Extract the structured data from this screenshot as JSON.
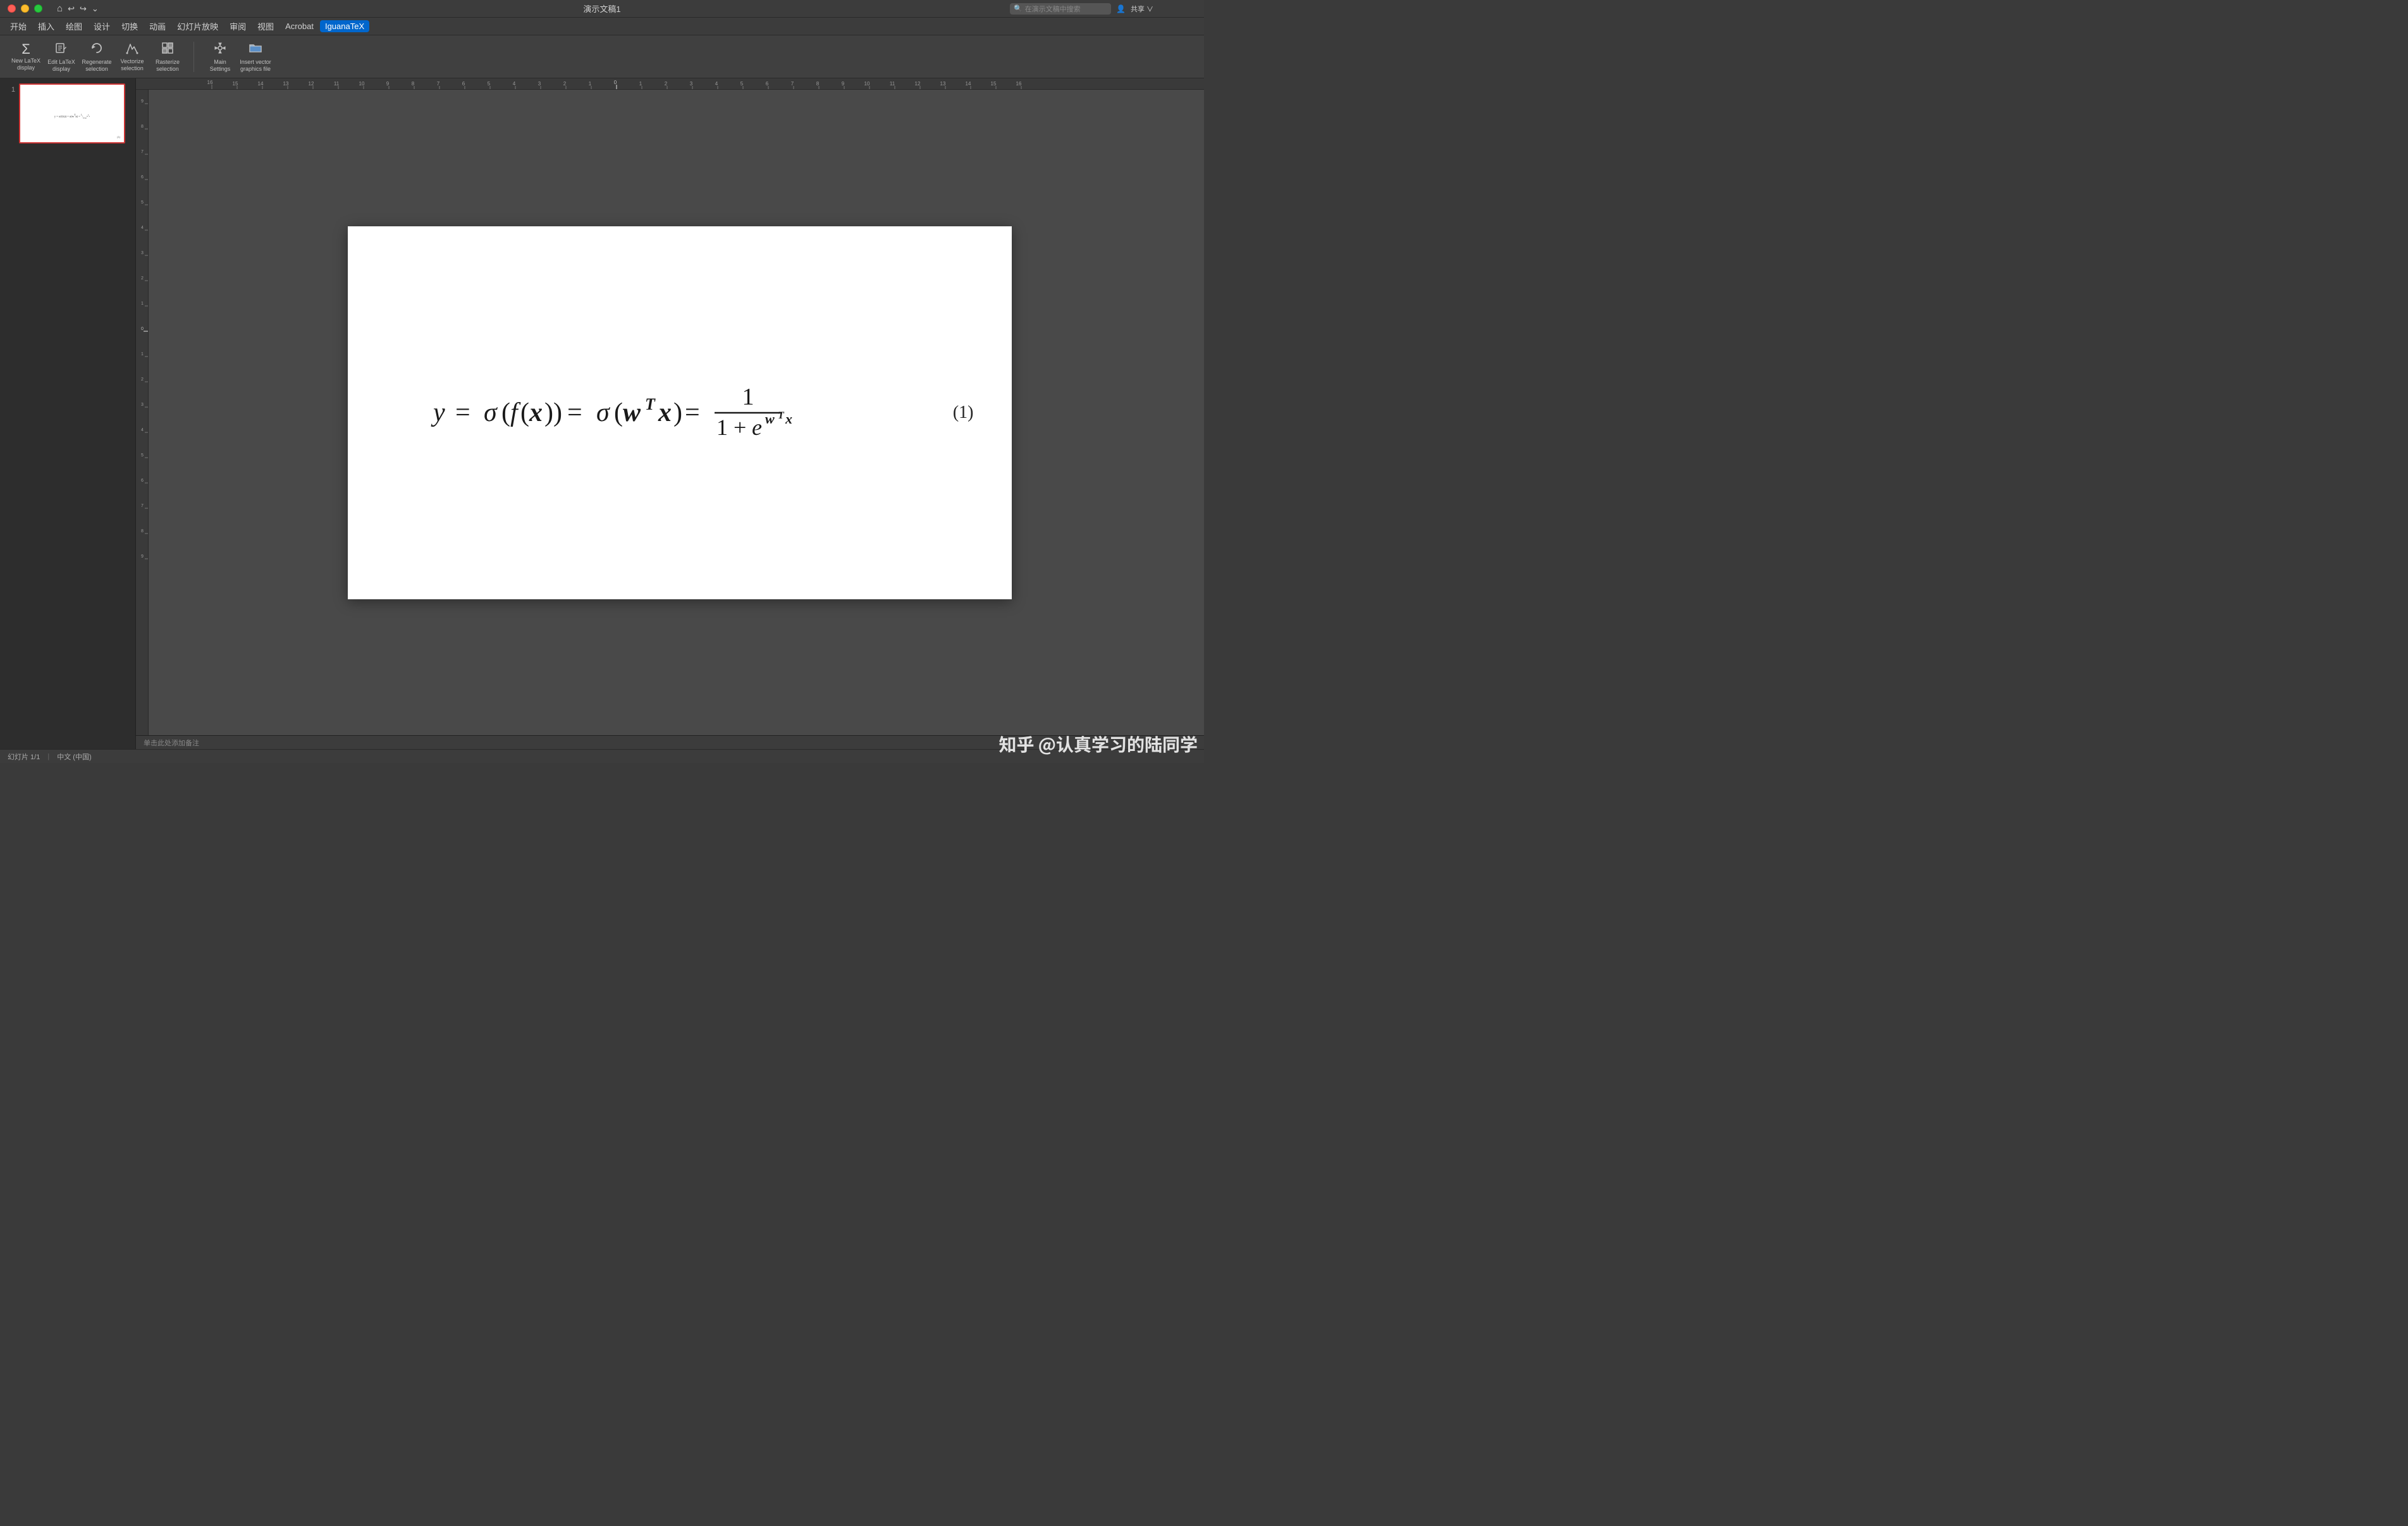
{
  "titlebar": {
    "title": "演示文稿1",
    "search_placeholder": "在演示文稿中搜索"
  },
  "menubar": {
    "items": [
      "开始",
      "插入",
      "绘图",
      "设计",
      "切换",
      "动画",
      "幻灯片放映",
      "审阅",
      "视图",
      "Acrobat",
      "IguanaTeX"
    ]
  },
  "ribbon": {
    "groups": [
      {
        "buttons": [
          {
            "id": "new-latex",
            "icon": "Σ",
            "label": "New LaTeX\ndisplay"
          },
          {
            "id": "edit-latex",
            "icon": "✎",
            "label": "Edit LaTeX\ndisplay"
          },
          {
            "id": "regenerate",
            "icon": "↺",
            "label": "Regenerate\nselection"
          },
          {
            "id": "vectorize",
            "icon": "⟨⟩",
            "label": "Vectorize\nselection"
          },
          {
            "id": "rasterize",
            "icon": "⊞",
            "label": "Rasterize\nselection"
          }
        ]
      },
      {
        "buttons": [
          {
            "id": "main-settings",
            "icon": "⚙",
            "label": "Main\nSettings"
          },
          {
            "id": "insert-vector",
            "icon": "📁",
            "label": "Insert vector\ngraphics file"
          }
        ]
      }
    ],
    "share_label": "共享 ∨"
  },
  "sidebar": {
    "slides": [
      {
        "number": "1",
        "has_formula": true,
        "formula_mini": "y = σ(f(x)) = σ(wᵀx) = 1/(1+e^wᵀx)"
      }
    ]
  },
  "slide": {
    "formula_display": "y = σ(f(x)) = σ(wᵀx) = 1/(1+e^(wᵀx))",
    "equation_number": "(1)",
    "notes_placeholder": "单击此处添加备注"
  },
  "statusbar": {
    "slide_info": "幻灯片 1/1",
    "language": "中文 (中国)"
  },
  "watermark": "知乎 @认真学习的陆同学"
}
